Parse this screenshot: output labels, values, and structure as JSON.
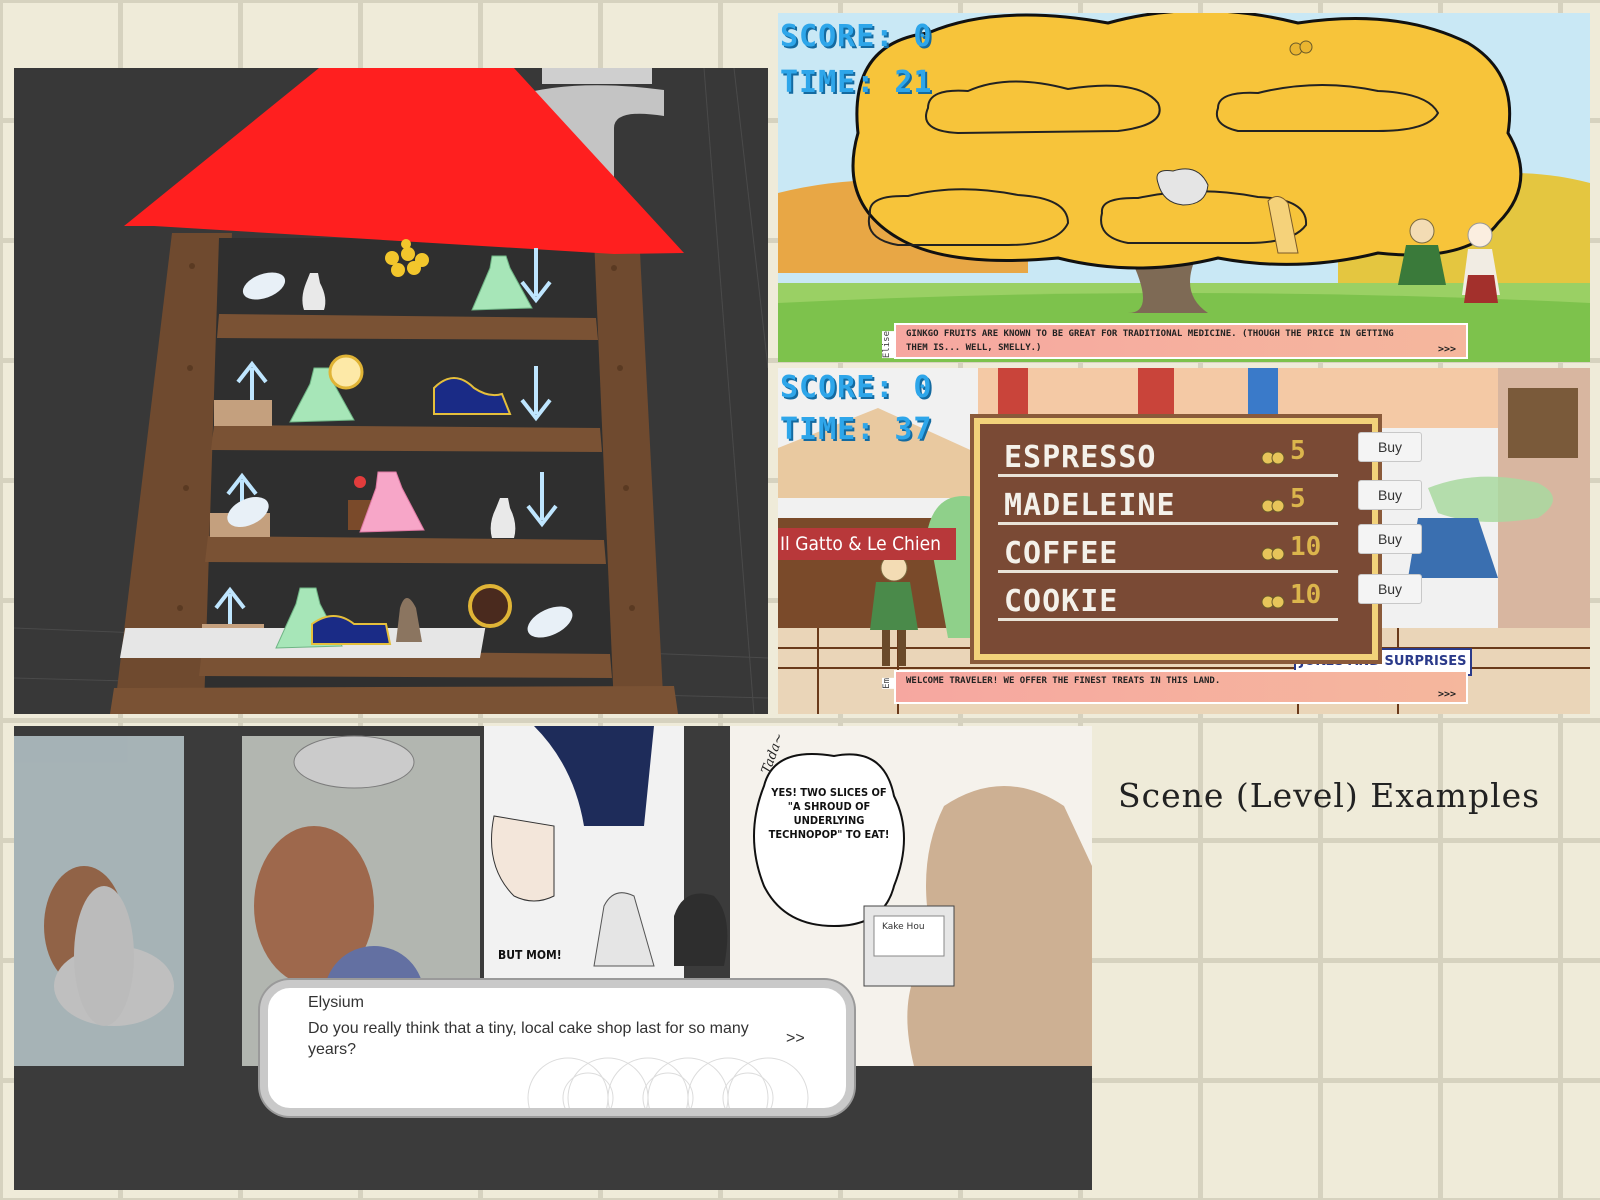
{
  "caption": "Scene (Level) Examples",
  "tree_game": {
    "score_label": "SCORE: 0",
    "time_label": "TIME: 21",
    "dialogue": {
      "speaker": "Elise",
      "text": "GINKGO FRUITS ARE KNOWN TO BE GREAT FOR TRADITIONAL MEDICINE. (THOUGH THE PRICE IN GETTING THEM IS... WELL, SMELLY.)",
      "next": ">>>"
    }
  },
  "shop_game": {
    "score_label": "SCORE: 0",
    "time_label": "TIME: 37",
    "shop_sign": "Il Gatto & Le Chien",
    "jokes_sign": "JOKES AND SURPRISES",
    "menu": [
      {
        "name": "ESPRESSO",
        "price": "5",
        "buy": "Buy"
      },
      {
        "name": "MADELEINE",
        "price": "5",
        "buy": "Buy"
      },
      {
        "name": "COFFEE",
        "price": "10",
        "buy": "Buy"
      },
      {
        "name": "COOKIE",
        "price": "10",
        "buy": "Buy"
      }
    ],
    "dialogue": {
      "speaker": "Em",
      "text": "WELCOME TRAVELER! WE OFFER THE FINEST TREATS IN THIS LAND.",
      "next": ">>>"
    }
  },
  "comic": {
    "speech_bubble": "YES! TWO SLICES OF \"A SHROUD OF UNDERLYING TECHNOPOP\" TO EAT!",
    "tada": "Tada~",
    "but_mom": "BUT MOM!",
    "box_sign": "Kake Hou",
    "dialogue": {
      "speaker": "Elysium",
      "text": "Do you really think that a tiny, local cake shop last for so many years?",
      "next": ">>"
    }
  },
  "colors": {
    "roof": "#ff1f1f",
    "wood": "#6f4a2f",
    "hud_blue": "#2ea6ea",
    "gold": "#dbb54c",
    "editor_bg": "#3a3a3a"
  }
}
